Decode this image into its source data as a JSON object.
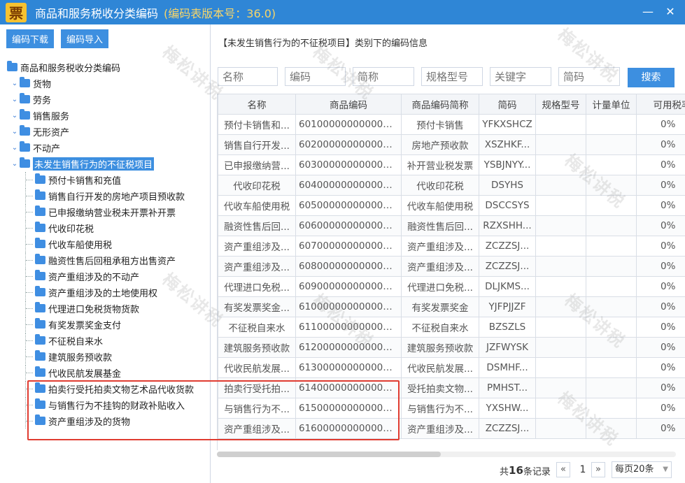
{
  "titlebar": {
    "icon_glyph": "票",
    "title": "商品和服务税收分类编码",
    "version": "(编码表版本号：36.0)",
    "min_glyph": "—",
    "close_glyph": "✕"
  },
  "toolbar": {
    "download_label": "编码下载",
    "import_label": "编码导入"
  },
  "tree": {
    "root": "商品和服务税收分类编码",
    "top_items": [
      "货物",
      "劳务",
      "销售服务",
      "无形资产",
      "不动产",
      "未发生销售行为的不征税项目"
    ],
    "children": [
      "预付卡销售和充值",
      "销售自行开发的房地产项目预收款",
      "已申报缴纳营业税未开票补开票",
      "代收印花税",
      "代收车船使用税",
      "融资性售后回租承租方出售资产",
      "资产重组涉及的不动产",
      "资产重组涉及的土地使用权",
      "代理进口免税货物货款",
      "有奖发票奖金支付",
      "不征税自来水",
      "建筑服务预收款",
      "代收民航发展基金",
      "拍卖行受托拍卖文物艺术品代收货款",
      "与销售行为不挂钩的财政补贴收入",
      "资产重组涉及的货物"
    ]
  },
  "main": {
    "section_head": "【未发生销售行为的不征税项目】类别下的编码信息",
    "filters": [
      {
        "placeholder": "名称"
      },
      {
        "placeholder": "编码"
      },
      {
        "placeholder": "简称"
      },
      {
        "placeholder": "规格型号"
      },
      {
        "placeholder": "关键字"
      },
      {
        "placeholder": "简码"
      }
    ],
    "search_label": "搜索",
    "columns": [
      "名称",
      "商品编码",
      "商品编码简称",
      "简码",
      "规格型号",
      "计量单位",
      "可用税率"
    ],
    "rows": [
      [
        "预付卡销售和...",
        "6010000000000000...",
        "预付卡销售",
        "YFKXSHCZ",
        "",
        "",
        "0%"
      ],
      [
        "销售自行开发...",
        "6020000000000000...",
        "房地产预收款",
        "XSZHKF...",
        "",
        "",
        "0%"
      ],
      [
        "已申报缴纳营...",
        "6030000000000000...",
        "补开营业税发票",
        "YSBJNYY...",
        "",
        "",
        "0%"
      ],
      [
        "代收印花税",
        "6040000000000000...",
        "代收印花税",
        "DSYHS",
        "",
        "",
        "0%"
      ],
      [
        "代收车船使用税",
        "6050000000000000...",
        "代收车船使用税",
        "DSCCSYS",
        "",
        "",
        "0%"
      ],
      [
        "融资性售后回...",
        "6060000000000000...",
        "融资性售后回...",
        "RZXSHH...",
        "",
        "",
        "0%"
      ],
      [
        "资产重组涉及...",
        "6070000000000000...",
        "资产重组涉及...",
        "ZCZZSJ...",
        "",
        "",
        "0%"
      ],
      [
        "资产重组涉及...",
        "6080000000000000...",
        "资产重组涉及...",
        "ZCZZSJ...",
        "",
        "",
        "0%"
      ],
      [
        "代理进口免税...",
        "6090000000000000...",
        "代理进口免税...",
        "DLJKMS...",
        "",
        "",
        "0%"
      ],
      [
        "有奖发票奖金...",
        "6100000000000000...",
        "有奖发票奖金",
        "YJFPJJZF",
        "",
        "",
        "0%"
      ],
      [
        "不征税自来水",
        "6110000000000000...",
        "不征税自来水",
        "BZSZLS",
        "",
        "",
        "0%"
      ],
      [
        "建筑服务预收款",
        "6120000000000000...",
        "建筑服务预收款",
        "JZFWYSK",
        "",
        "",
        "0%"
      ],
      [
        "代收民航发展...",
        "6130000000000000...",
        "代收民航发展...",
        "DSMHF...",
        "",
        "",
        "0%"
      ],
      [
        "拍卖行受托拍...",
        "6140000000000000...",
        "受托拍卖文物...",
        "PMHST...",
        "",
        "",
        "0%"
      ],
      [
        "与销售行为不...",
        "6150000000000000...",
        "与销售行为不...",
        "YXSHW...",
        "",
        "",
        "0%"
      ],
      [
        "资产重组涉及...",
        "6160000000000000...",
        "资产重组涉及...",
        "ZCZZSJ...",
        "",
        "",
        "0%"
      ]
    ]
  },
  "pager": {
    "prefix": "共",
    "total": "16",
    "suffix": "条记录",
    "prev": "«",
    "current": "1",
    "next": "»",
    "page_size": "每页20条",
    "size_arrow": "▼"
  },
  "watermark": "梅松讲税"
}
